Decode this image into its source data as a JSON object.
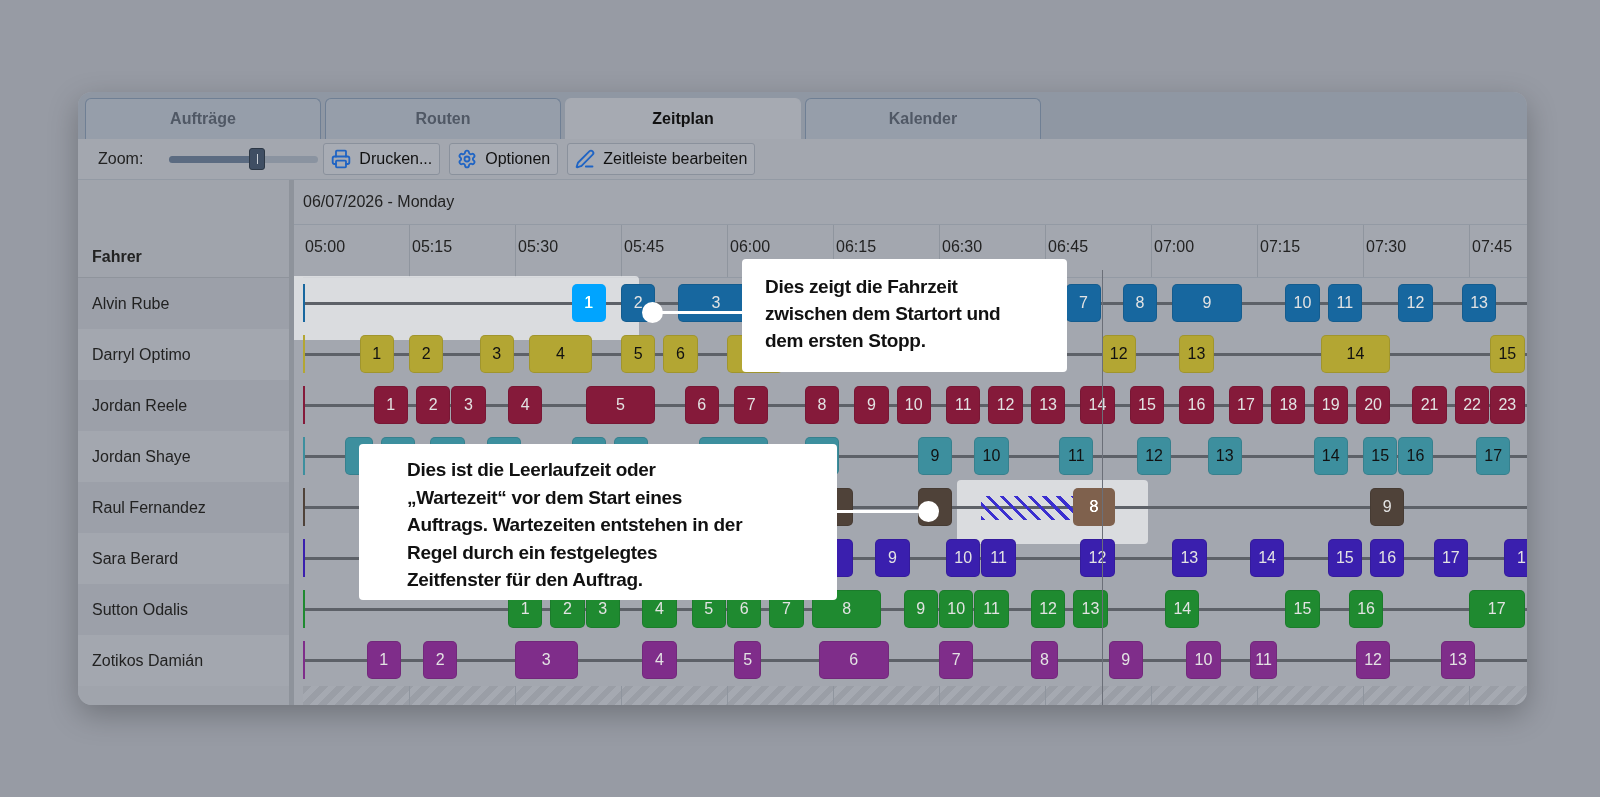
{
  "tabs": [
    {
      "label": "Aufträge",
      "selected": false
    },
    {
      "label": "Routen",
      "selected": false
    },
    {
      "label": "Zeitplan",
      "selected": true
    },
    {
      "label": "Kalender",
      "selected": false
    }
  ],
  "toolbar": {
    "zoom_label": "Zoom:",
    "zoom": {
      "level": 0.59
    },
    "buttons": [
      "Drucken...",
      "Optionen",
      "Zeitleiste bearbeiten"
    ]
  },
  "schedule": {
    "date": "06/07/2026 - Monday",
    "driver_heading": "Fahrer",
    "times": [
      "05:00",
      "05:15",
      "05:30",
      "05:45",
      "06:00",
      "06:15",
      "06:30",
      "06:45",
      "07:00",
      "07:15",
      "07:30",
      "07:45"
    ],
    "drivers": [
      {
        "name": "Alvin Rube",
        "color": "#17679f",
        "waiting": false,
        "blocks": [
          {
            "label": "1",
            "highlighted": true
          },
          {
            "label": "2",
            "highlighted": false
          },
          {
            "label": "3",
            "highlighted": false
          },
          {
            "label": "7",
            "highlighted": false
          },
          {
            "label": "8",
            "highlighted": false
          },
          {
            "label": "9",
            "highlighted": false
          },
          {
            "label": "10",
            "highlighted": false
          },
          {
            "label": "11",
            "highlighted": false
          },
          {
            "label": "12",
            "highlighted": false
          },
          {
            "label": "13",
            "highlighted": false
          }
        ]
      },
      {
        "name": "Darryl Optimo",
        "color": "#b3a633",
        "waiting": false,
        "blocks": [
          {
            "label": "1",
            "highlighted": false
          },
          {
            "label": "2",
            "highlighted": false
          },
          {
            "label": "3",
            "highlighted": false
          },
          {
            "label": "4",
            "highlighted": false
          },
          {
            "label": "5",
            "highlighted": false
          },
          {
            "label": "6",
            "highlighted": false
          },
          {
            "highlighted": false
          },
          {
            "label": "12",
            "highlighted": false
          },
          {
            "label": "13",
            "highlighted": false
          },
          {
            "label": "14",
            "highlighted": false
          },
          {
            "label": "15",
            "highlighted": false
          }
        ]
      },
      {
        "name": "Jordan Reele",
        "color": "#851a3a",
        "waiting": false,
        "blocks": [
          {
            "label": "1",
            "highlighted": false
          },
          {
            "label": "2",
            "highlighted": false
          },
          {
            "label": "3",
            "highlighted": false
          },
          {
            "label": "4",
            "highlighted": false
          },
          {
            "label": "5",
            "highlighted": false
          },
          {
            "label": "6",
            "highlighted": false
          },
          {
            "label": "7",
            "highlighted": false
          },
          {
            "label": "8",
            "highlighted": false
          },
          {
            "label": "9",
            "highlighted": false
          },
          {
            "label": "10",
            "highlighted": false
          },
          {
            "label": "11",
            "highlighted": false
          },
          {
            "label": "12",
            "highlighted": false
          },
          {
            "label": "13",
            "highlighted": false
          },
          {
            "label": "14",
            "highlighted": false
          },
          {
            "label": "15",
            "highlighted": false
          },
          {
            "label": "16",
            "highlighted": false
          },
          {
            "label": "17",
            "highlighted": false
          },
          {
            "label": "18",
            "highlighted": false
          },
          {
            "label": "19",
            "highlighted": false
          },
          {
            "label": "20",
            "highlighted": false
          },
          {
            "label": "21",
            "highlighted": false
          },
          {
            "label": "22",
            "highlighted": false
          },
          {
            "label": "23",
            "highlighted": false
          }
        ]
      },
      {
        "name": "Jordan Shaye",
        "color": "#3d8f9e",
        "waiting": false,
        "blocks": [
          {
            "highlighted": false
          },
          {
            "highlighted": false
          },
          {
            "highlighted": false
          },
          {
            "highlighted": false
          },
          {
            "highlighted": false
          },
          {
            "highlighted": false
          },
          {
            "highlighted": false
          },
          {
            "highlighted": false
          },
          {
            "label": "9",
            "highlighted": false
          },
          {
            "label": "10",
            "highlighted": false
          },
          {
            "label": "11",
            "highlighted": false
          },
          {
            "label": "12",
            "highlighted": false
          },
          {
            "label": "13",
            "highlighted": false
          },
          {
            "label": "14",
            "highlighted": false
          },
          {
            "label": "15",
            "highlighted": false
          },
          {
            "label": "16",
            "highlighted": false
          },
          {
            "label": "17",
            "highlighted": false
          }
        ]
      },
      {
        "name": "Raul Fernandez",
        "color": "#4f4239",
        "waiting": true,
        "blocks": [
          {
            "highlighted": false
          },
          {
            "highlighted": false
          },
          {
            "label": "8",
            "highlighted": true
          },
          {
            "label": "9",
            "highlighted": false
          }
        ]
      },
      {
        "name": "Sara Berard",
        "color": "#3a1fae",
        "waiting": false,
        "blocks": [
          {
            "highlighted": false
          },
          {
            "label": "9",
            "highlighted": false
          },
          {
            "label": "10",
            "highlighted": false
          },
          {
            "label": "11",
            "highlighted": false
          },
          {
            "label": "12",
            "highlighted": false
          },
          {
            "label": "13",
            "highlighted": false
          },
          {
            "label": "14",
            "highlighted": false
          },
          {
            "label": "15",
            "highlighted": false
          },
          {
            "label": "16",
            "highlighted": false
          },
          {
            "label": "17",
            "highlighted": false
          },
          {
            "label": "1",
            "highlighted": false
          }
        ]
      },
      {
        "name": "Sutton Odalis",
        "color": "#1f8a30",
        "waiting": false,
        "blocks": [
          {
            "label": "1",
            "highlighted": false
          },
          {
            "label": "2",
            "highlighted": false
          },
          {
            "label": "3",
            "highlighted": false
          },
          {
            "label": "4",
            "highlighted": false
          },
          {
            "label": "5",
            "highlighted": false
          },
          {
            "label": "6",
            "highlighted": false
          },
          {
            "label": "7",
            "highlighted": false
          },
          {
            "label": "8",
            "highlighted": false
          },
          {
            "label": "9",
            "highlighted": false
          },
          {
            "label": "10",
            "highlighted": false
          },
          {
            "label": "11",
            "highlighted": false
          },
          {
            "label": "12",
            "highlighted": false
          },
          {
            "label": "13",
            "highlighted": false
          },
          {
            "label": "14",
            "highlighted": false
          },
          {
            "label": "15",
            "highlighted": false
          },
          {
            "label": "16",
            "highlighted": false
          },
          {
            "label": "17",
            "highlighted": false
          }
        ]
      },
      {
        "name": "Zotikos Damián",
        "color": "#7f2d8a",
        "waiting": false,
        "blocks": [
          {
            "label": "1",
            "highlighted": false
          },
          {
            "label": "2",
            "highlighted": false
          },
          {
            "label": "3",
            "highlighted": false
          },
          {
            "label": "4",
            "highlighted": false
          },
          {
            "label": "5",
            "highlighted": false
          },
          {
            "label": "6",
            "highlighted": false
          },
          {
            "label": "7",
            "highlighted": false
          },
          {
            "label": "8",
            "highlighted": false
          },
          {
            "label": "9",
            "highlighted": false
          },
          {
            "label": "10",
            "highlighted": false
          },
          {
            "label": "11",
            "highlighted": false
          },
          {
            "label": "12",
            "highlighted": false
          },
          {
            "label": "13",
            "highlighted": false
          }
        ]
      }
    ]
  },
  "callouts": [
    {
      "text": "Dies zeigt die Fahrzeit zwischen dem Startort und dem ersten Stopp."
    },
    {
      "text": "Dies ist die Leerlaufzeit oder „Wartezeit“ vor dem Start eines Auftrags. Wartezeiten entstehen in der Regel durch ein festgelegtes Zeitfenster für den Auftrag."
    }
  ]
}
